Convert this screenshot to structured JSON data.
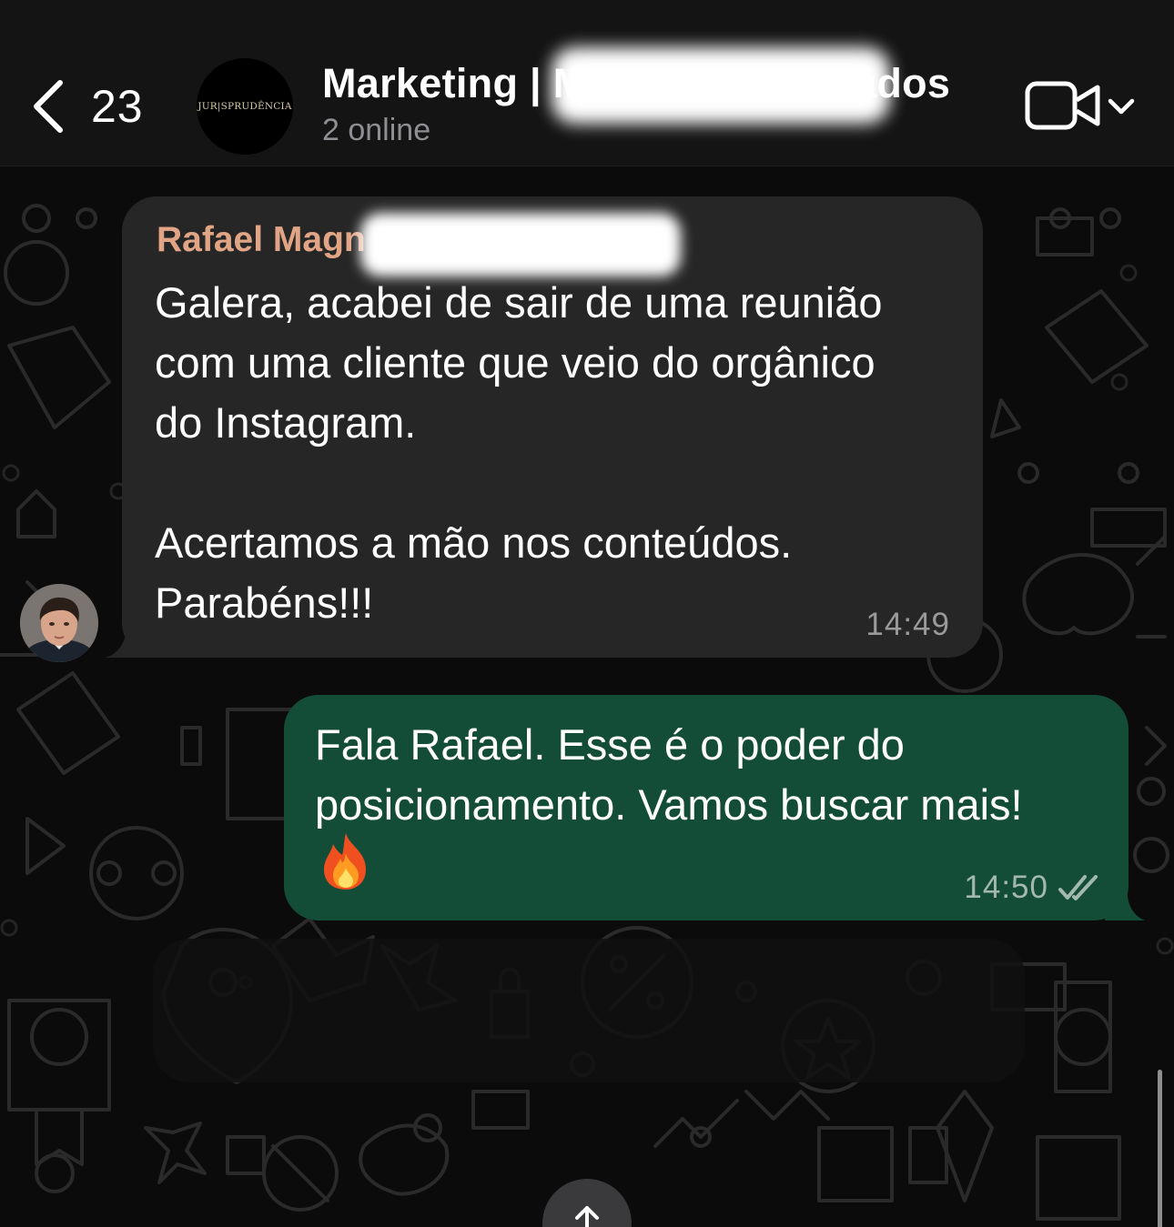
{
  "header": {
    "back_label": "23",
    "title_prefix": "Marketing | M",
    "title_suffix": "ados",
    "status": "2 online",
    "avatar_logo_text": "JUR|SPRUDÊNCIA",
    "video_icon": "video-camera-icon",
    "dropdown_icon": "chevron-down-icon"
  },
  "messages": [
    {
      "direction": "incoming",
      "sender": "Rafael Magn",
      "text": "Galera, acabei de sair de uma reunião\ncom uma cliente que veio do orgânico\ndo Instagram.\n\nAcertamos a mão nos conteúdos.\nParabéns!!!",
      "time": "14:49"
    },
    {
      "direction": "outgoing",
      "text": "Fala Rafael. Esse é o poder do\nposicionamento. Vamos buscar mais!",
      "emoji": "fire-emoji",
      "time": "14:50",
      "receipt": "double-check-icon"
    }
  ],
  "colors": {
    "header_bg": "#141414",
    "incoming_bubble": "#262626",
    "outgoing_bubble": "#144d37",
    "sender_name": "#e1a586",
    "wallpaper": "#0b0b0b"
  }
}
